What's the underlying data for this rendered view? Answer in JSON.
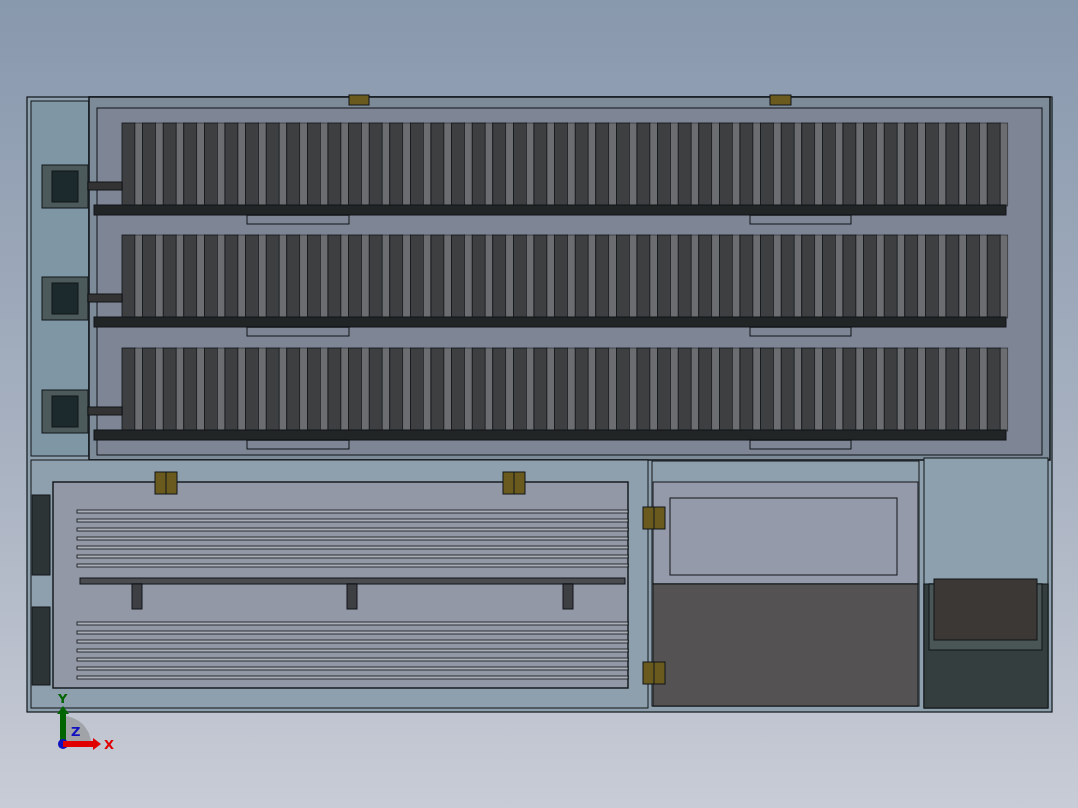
{
  "viewport": {
    "triad": [
      {
        "kind": "y",
        "label": "Y",
        "color": "#006400"
      },
      {
        "kind": "z",
        "label": "Z",
        "color": "#1010c0"
      },
      {
        "kind": "x",
        "label": "X",
        "color": "#e00000"
      }
    ]
  }
}
